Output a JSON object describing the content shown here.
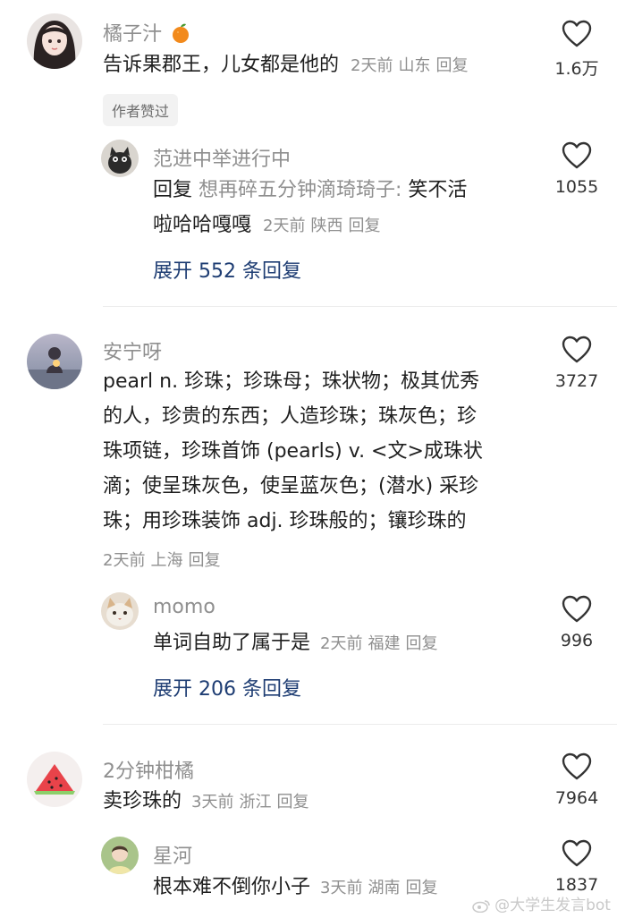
{
  "comments": [
    {
      "username": "橘子汁",
      "text": "告诉果郡王，儿女都是他的",
      "time": "2天前",
      "location": "山东",
      "reply_label": "回复",
      "likes": "1.6万",
      "badge": "作者赞过",
      "replies": [
        {
          "username": "范进中举进行中",
          "prefix": "回复",
          "quoted_user": "想再碎五分钟滴琦琦子:",
          "text_line1": " 笑不活",
          "text_line2": "啦哈哈嘎嘎",
          "time": "2天前",
          "location": "陕西",
          "reply_label": "回复",
          "likes": "1055"
        }
      ],
      "expand_label": "展开 552 条回复"
    },
    {
      "username": "安宁呀",
      "text_lines": [
        "pearl  n. 珍珠；珍珠母；珠状物；极其优秀",
        "的人，珍贵的东西；人造珍珠；珠灰色；珍",
        "珠项链，珍珠首饰 (pearls) v. <文>成珠状",
        "滴；使呈珠灰色，使呈蓝灰色；(潜水) 采珍",
        "珠；用珍珠装饰 adj. 珍珠般的；镶珍珠的"
      ],
      "time": "2天前",
      "location": "上海",
      "reply_label": "回复",
      "likes": "3727",
      "replies": [
        {
          "username": "momo",
          "text": "单词自助了属于是",
          "time": "2天前",
          "location": "福建",
          "reply_label": "回复",
          "likes": "996"
        }
      ],
      "expand_label": "展开 206 条回复"
    },
    {
      "username": "2分钟柑橘",
      "text": "卖珍珠的",
      "time": "3天前",
      "location": "浙江",
      "reply_label": "回复",
      "likes": "7964",
      "replies": [
        {
          "username": "星河",
          "text": "根本难不倒你小子",
          "time": "3天前",
          "location": "湖南",
          "reply_label": "回复",
          "likes": "1837"
        }
      ]
    }
  ],
  "watermark": "@大学生发言bot",
  "icons": {
    "like": "heart-outline-icon",
    "orange_emoji": "orange-emoji-icon",
    "weibo": "weibo-logo-icon"
  },
  "colors": {
    "username": "#8f8f8f",
    "expand_link": "#1e3d73",
    "badge_bg": "#f2f2f2"
  }
}
